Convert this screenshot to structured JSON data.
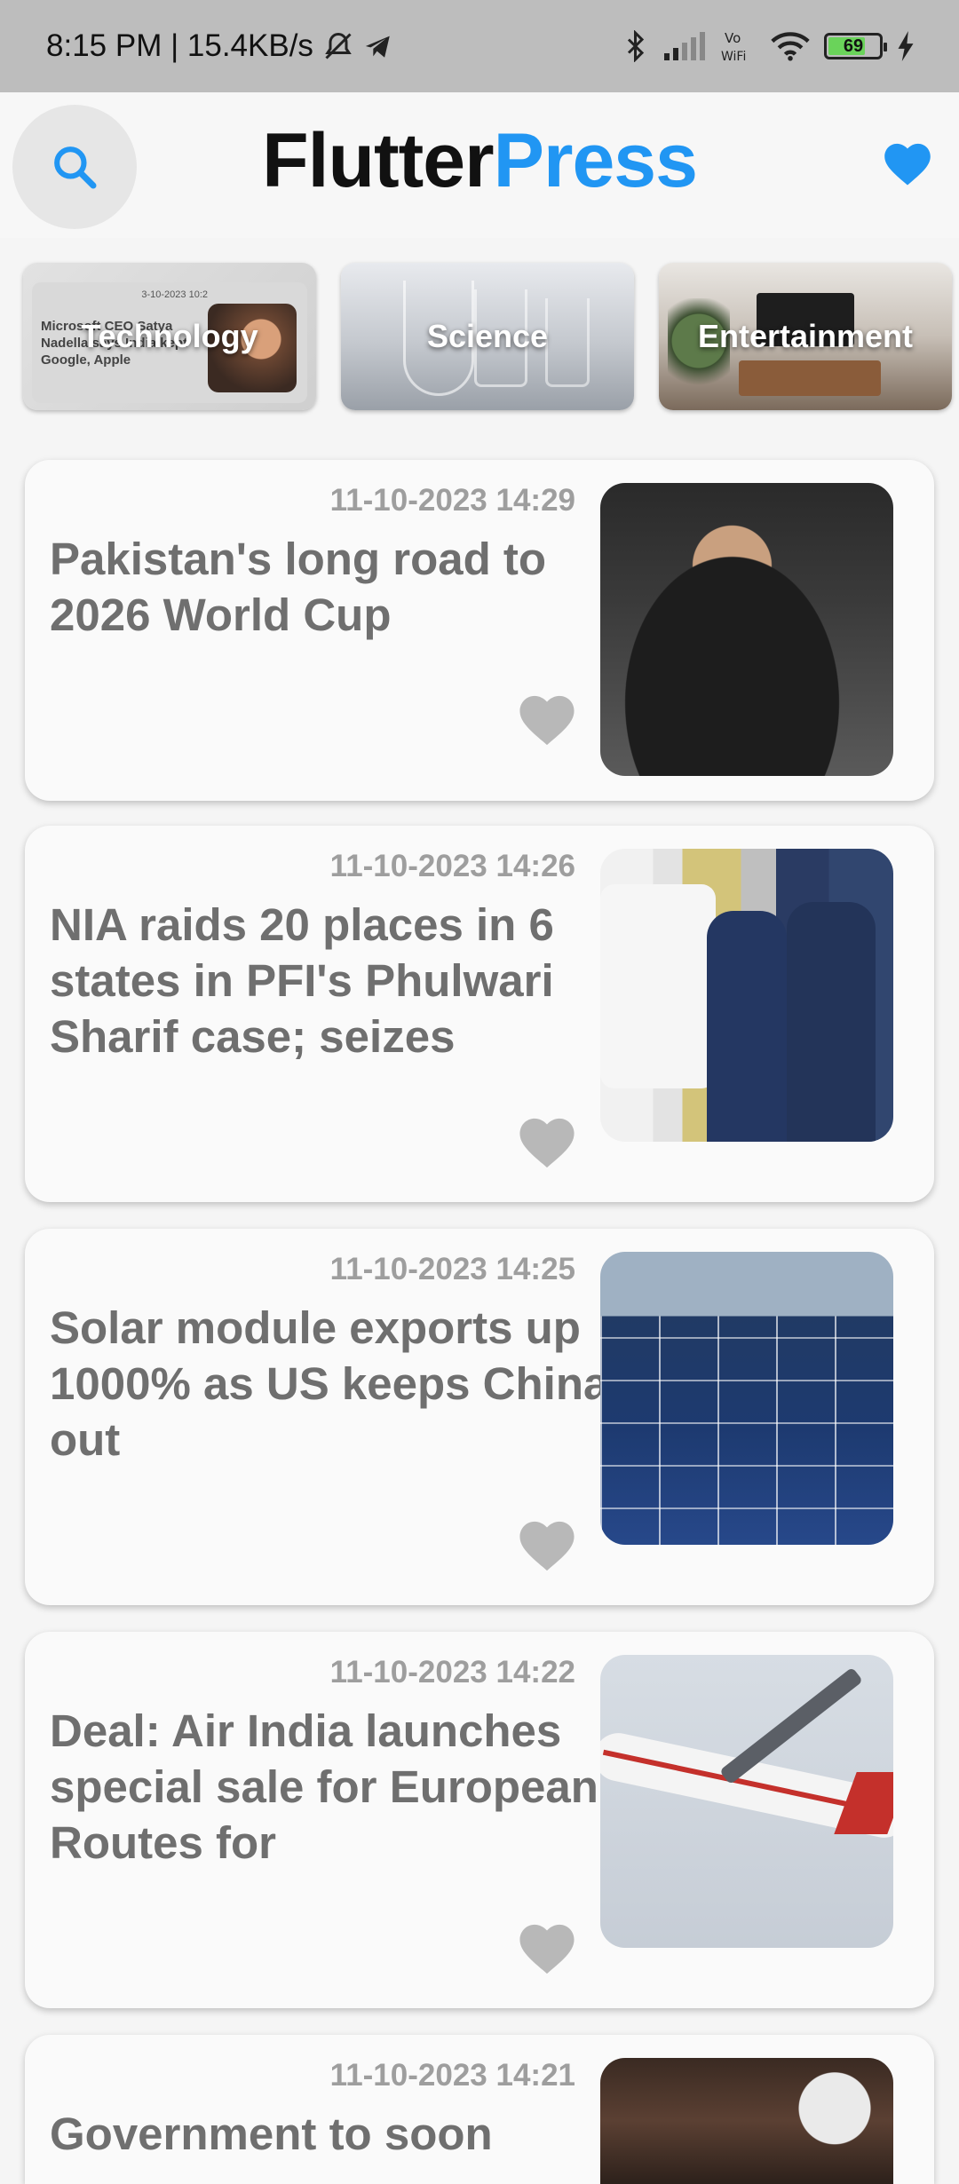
{
  "status_bar": {
    "time_speed": "8:15 PM | 15.4KB/s",
    "battery_level": "69"
  },
  "app_bar": {
    "title_part1": "Flutter",
    "title_part2": "Press",
    "accent_color": "#2196f3",
    "icons": [
      "search-icon",
      "heart-icon"
    ]
  },
  "categories": [
    {
      "label": "Technology",
      "preview_date": "3-10-2023 10:2",
      "preview_text": "Microsoft CEO Satya Nadella says India kept Google, Apple"
    },
    {
      "label": "Science"
    },
    {
      "label": "Entertainment"
    }
  ],
  "articles": [
    {
      "date": "11-10-2023 14:29",
      "title": "Pakistan's long road to 2026 World Cup"
    },
    {
      "date": "11-10-2023 14:26",
      "title": "NIA raids 20 places in 6 states in PFI's Phulwari Sharif case; seizes"
    },
    {
      "date": "11-10-2023 14:25",
      "title": "Solar module exports up 1000% as US keeps China out"
    },
    {
      "date": "11-10-2023 14:22",
      "title": "Deal: Air India launches special sale for European Routes for"
    },
    {
      "date": "11-10-2023 14:21",
      "title": "Government to soon"
    }
  ]
}
